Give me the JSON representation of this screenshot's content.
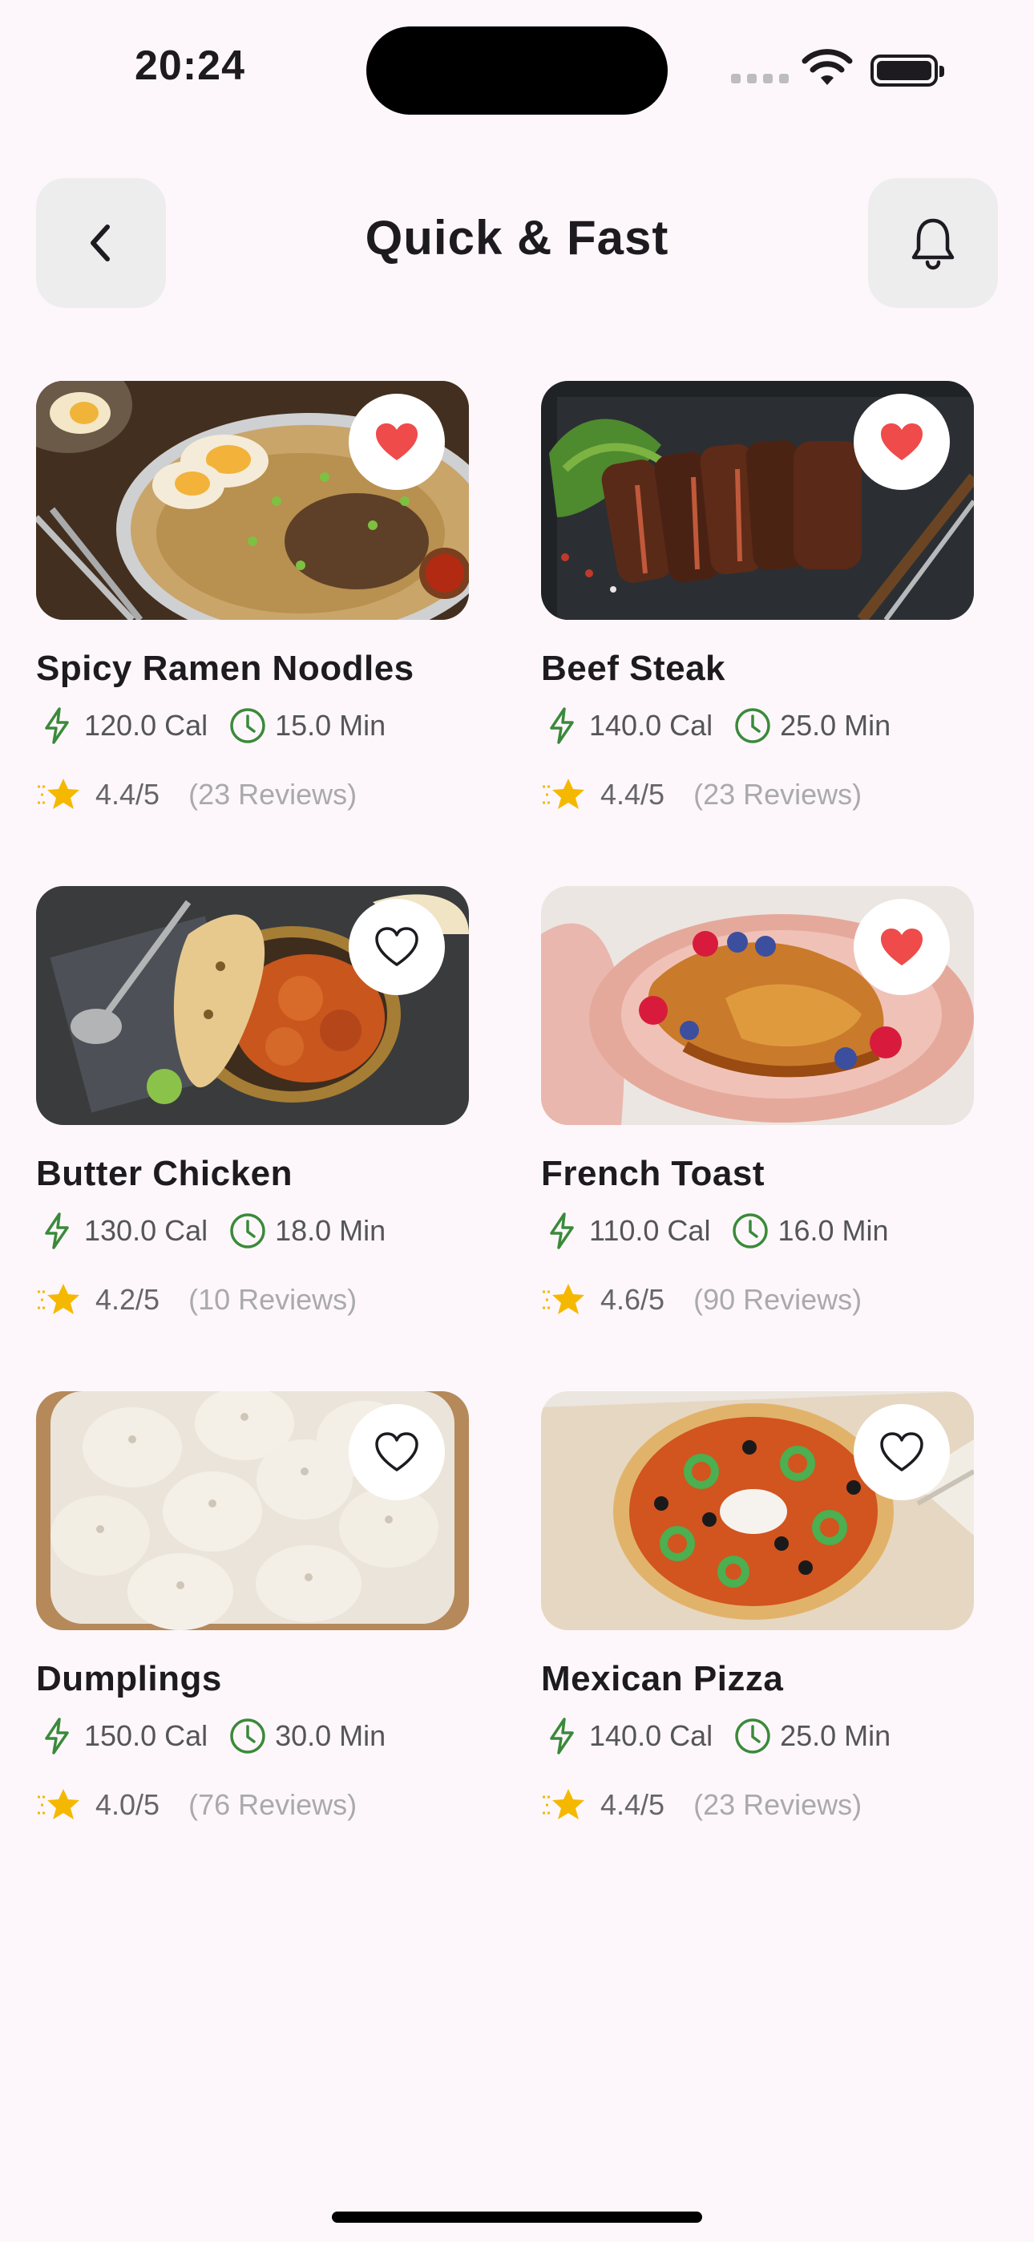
{
  "status_bar": {
    "time": "20:24"
  },
  "header": {
    "title": "Quick & Fast"
  },
  "recipes": [
    {
      "name": "Spicy Ramen Noodles",
      "calories": "120.0 Cal",
      "time": "15.0 Min",
      "rating": "4.4/5",
      "reviews": "(23 Reviews)",
      "favorite": true,
      "image": "ramen"
    },
    {
      "name": "Beef Steak",
      "calories": "140.0 Cal",
      "time": "25.0 Min",
      "rating": "4.4/5",
      "reviews": "(23 Reviews)",
      "favorite": true,
      "image": "steak"
    },
    {
      "name": "Butter Chicken",
      "calories": "130.0 Cal",
      "time": "18.0 Min",
      "rating": "4.2/5",
      "reviews": "(10 Reviews)",
      "favorite": false,
      "image": "butter-chicken"
    },
    {
      "name": "French Toast",
      "calories": "110.0 Cal",
      "time": "16.0 Min",
      "rating": "4.6/5",
      "reviews": "(90 Reviews)",
      "favorite": true,
      "image": "french-toast"
    },
    {
      "name": "Dumplings",
      "calories": "150.0 Cal",
      "time": "30.0 Min",
      "rating": "4.0/5",
      "reviews": "(76 Reviews)",
      "favorite": false,
      "image": "dumplings"
    },
    {
      "name": "Mexican Pizza",
      "calories": "140.0 Cal",
      "time": "25.0 Min",
      "rating": "4.4/5",
      "reviews": "(23 Reviews)",
      "favorite": false,
      "image": "pizza"
    }
  ],
  "colors": {
    "accent_green": "#3a8a3a",
    "heart_red": "#ef4b4b",
    "star_yellow": "#f5b800",
    "background": "#fdf7fb"
  }
}
